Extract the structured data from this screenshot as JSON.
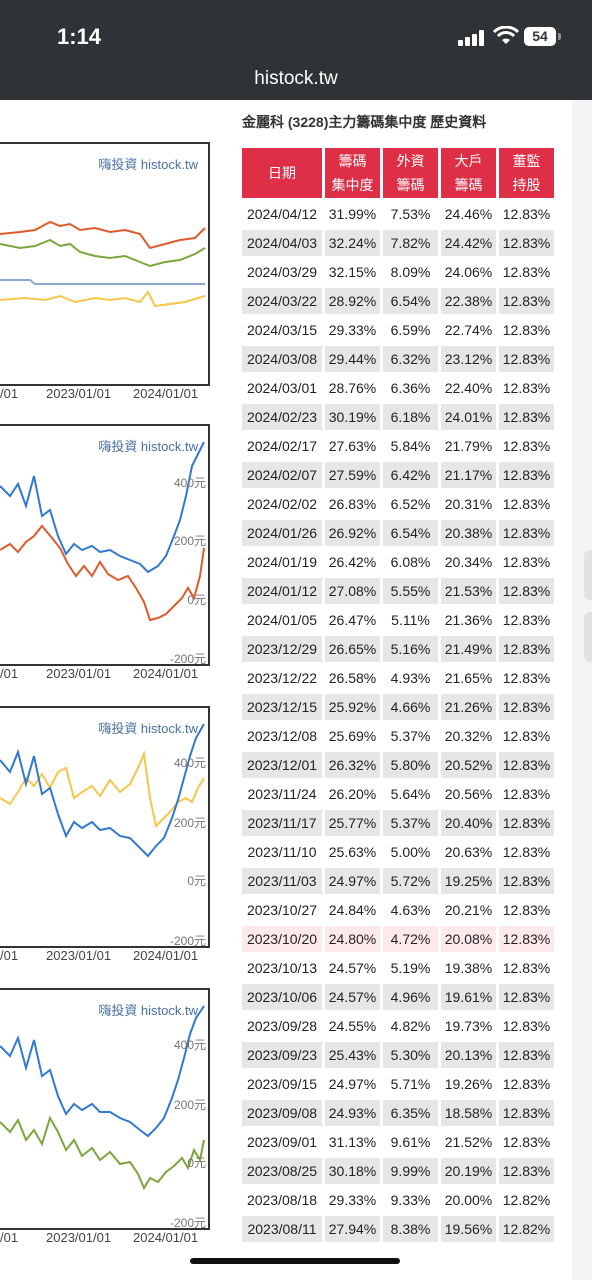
{
  "status": {
    "time": "1:14",
    "battery": "54"
  },
  "browser": {
    "url": "histock.tw"
  },
  "page": {
    "title": "金麗科 (3228)主力籌碼集中度 歷史資料"
  },
  "charts": {
    "watermark": "嗨投資 histock.tw",
    "x_labels": [
      "/01",
      "2023/01/01",
      "2024/01/01"
    ],
    "y_labels": [
      "400元",
      "200元",
      "0元",
      "-200元"
    ]
  },
  "table": {
    "headers": [
      {
        "line1": "日期",
        "line2": ""
      },
      {
        "line1": "籌碼",
        "line2": "集中度"
      },
      {
        "line1": "外資",
        "line2": "籌碼"
      },
      {
        "line1": "大戶",
        "line2": "籌碼"
      },
      {
        "line1": "董監",
        "line2": "持股"
      }
    ],
    "rows": [
      [
        "2024/04/12",
        "31.99%",
        "7.53%",
        "24.46%",
        "12.83%"
      ],
      [
        "2024/04/03",
        "32.24%",
        "7.82%",
        "24.42%",
        "12.83%"
      ],
      [
        "2024/03/29",
        "32.15%",
        "8.09%",
        "24.06%",
        "12.83%"
      ],
      [
        "2024/03/22",
        "28.92%",
        "6.54%",
        "22.38%",
        "12.83%"
      ],
      [
        "2024/03/15",
        "29.33%",
        "6.59%",
        "22.74%",
        "12.83%"
      ],
      [
        "2024/03/08",
        "29.44%",
        "6.32%",
        "23.12%",
        "12.83%"
      ],
      [
        "2024/03/01",
        "28.76%",
        "6.36%",
        "22.40%",
        "12.83%"
      ],
      [
        "2024/02/23",
        "30.19%",
        "6.18%",
        "24.01%",
        "12.83%"
      ],
      [
        "2024/02/17",
        "27.63%",
        "5.84%",
        "21.79%",
        "12.83%"
      ],
      [
        "2024/02/07",
        "27.59%",
        "6.42%",
        "21.17%",
        "12.83%"
      ],
      [
        "2024/02/02",
        "26.83%",
        "6.52%",
        "20.31%",
        "12.83%"
      ],
      [
        "2024/01/26",
        "26.92%",
        "6.54%",
        "20.38%",
        "12.83%"
      ],
      [
        "2024/01/19",
        "26.42%",
        "6.08%",
        "20.34%",
        "12.83%"
      ],
      [
        "2024/01/12",
        "27.08%",
        "5.55%",
        "21.53%",
        "12.83%"
      ],
      [
        "2024/01/05",
        "26.47%",
        "5.11%",
        "21.36%",
        "12.83%"
      ],
      [
        "2023/12/29",
        "26.65%",
        "5.16%",
        "21.49%",
        "12.83%"
      ],
      [
        "2023/12/22",
        "26.58%",
        "4.93%",
        "21.65%",
        "12.83%"
      ],
      [
        "2023/12/15",
        "25.92%",
        "4.66%",
        "21.26%",
        "12.83%"
      ],
      [
        "2023/12/08",
        "25.69%",
        "5.37%",
        "20.32%",
        "12.83%"
      ],
      [
        "2023/12/01",
        "26.32%",
        "5.80%",
        "20.52%",
        "12.83%"
      ],
      [
        "2023/11/24",
        "26.20%",
        "5.64%",
        "20.56%",
        "12.83%"
      ],
      [
        "2023/11/17",
        "25.77%",
        "5.37%",
        "20.40%",
        "12.83%"
      ],
      [
        "2023/11/10",
        "25.63%",
        "5.00%",
        "20.63%",
        "12.83%"
      ],
      [
        "2023/11/03",
        "24.97%",
        "5.72%",
        "19.25%",
        "12.83%"
      ],
      [
        "2023/10/27",
        "24.84%",
        "4.63%",
        "20.21%",
        "12.83%"
      ],
      [
        "2023/10/20",
        "24.80%",
        "4.72%",
        "20.08%",
        "12.83%"
      ],
      [
        "2023/10/13",
        "24.57%",
        "5.19%",
        "19.38%",
        "12.83%"
      ],
      [
        "2023/10/06",
        "24.57%",
        "4.96%",
        "19.61%",
        "12.83%"
      ],
      [
        "2023/09/28",
        "24.55%",
        "4.82%",
        "19.73%",
        "12.83%"
      ],
      [
        "2023/09/23",
        "25.43%",
        "5.30%",
        "20.13%",
        "12.83%"
      ],
      [
        "2023/09/15",
        "24.97%",
        "5.71%",
        "19.26%",
        "12.83%"
      ],
      [
        "2023/09/08",
        "24.93%",
        "6.35%",
        "18.58%",
        "12.83%"
      ],
      [
        "2023/09/01",
        "31.13%",
        "9.61%",
        "21.52%",
        "12.83%"
      ],
      [
        "2023/08/25",
        "30.18%",
        "9.99%",
        "20.19%",
        "12.83%"
      ],
      [
        "2023/08/18",
        "29.33%",
        "9.33%",
        "20.00%",
        "12.82%"
      ],
      [
        "2023/08/11",
        "27.94%",
        "8.38%",
        "19.56%",
        "12.82%"
      ]
    ],
    "highlight_row": 25
  },
  "colors": {
    "header_bg": "#de2f47",
    "orange": "#e05a2b",
    "green": "#7aa63a",
    "blue": "#2f79d0",
    "yellow": "#f7c64a",
    "gray_blue": "#8aa8d0"
  }
}
